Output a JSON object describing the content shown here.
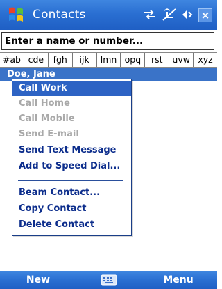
{
  "titlebar": {
    "title": "Contacts",
    "icons": [
      "start-flag-icon",
      "connectivity-icon",
      "signal-icon",
      "volume-icon",
      "close-icon"
    ],
    "close_label": "×"
  },
  "search": {
    "placeholder": "Enter a name or number..."
  },
  "alphabet_tabs": [
    "#ab",
    "cde",
    "fgh",
    "ijk",
    "lmn",
    "opq",
    "rst",
    "uvw",
    "xyz"
  ],
  "contact": {
    "name": "Doe, Jane"
  },
  "context_menu": {
    "items": [
      {
        "label": "Call Work",
        "state": "selected"
      },
      {
        "label": "Call Home",
        "state": "disabled"
      },
      {
        "label": "Call Mobile",
        "state": "disabled"
      },
      {
        "label": "Send E-mail",
        "state": "disabled"
      },
      {
        "label": "Send Text Message",
        "state": "enabled"
      },
      {
        "label": "Add to Speed Dial...",
        "state": "enabled"
      },
      {
        "label": "Beam Contact...",
        "state": "enabled"
      },
      {
        "label": "Copy Contact",
        "state": "enabled"
      },
      {
        "label": "Delete Contact",
        "state": "enabled"
      }
    ]
  },
  "softkeys": {
    "left": "New",
    "right": "Menu",
    "center_icon": "keyboard-icon"
  },
  "colors": {
    "title_bar": "#2a6fd2",
    "selection": "#2d63c4",
    "menu_text": "#0c2d8c",
    "disabled_text": "#a9a9a9"
  }
}
